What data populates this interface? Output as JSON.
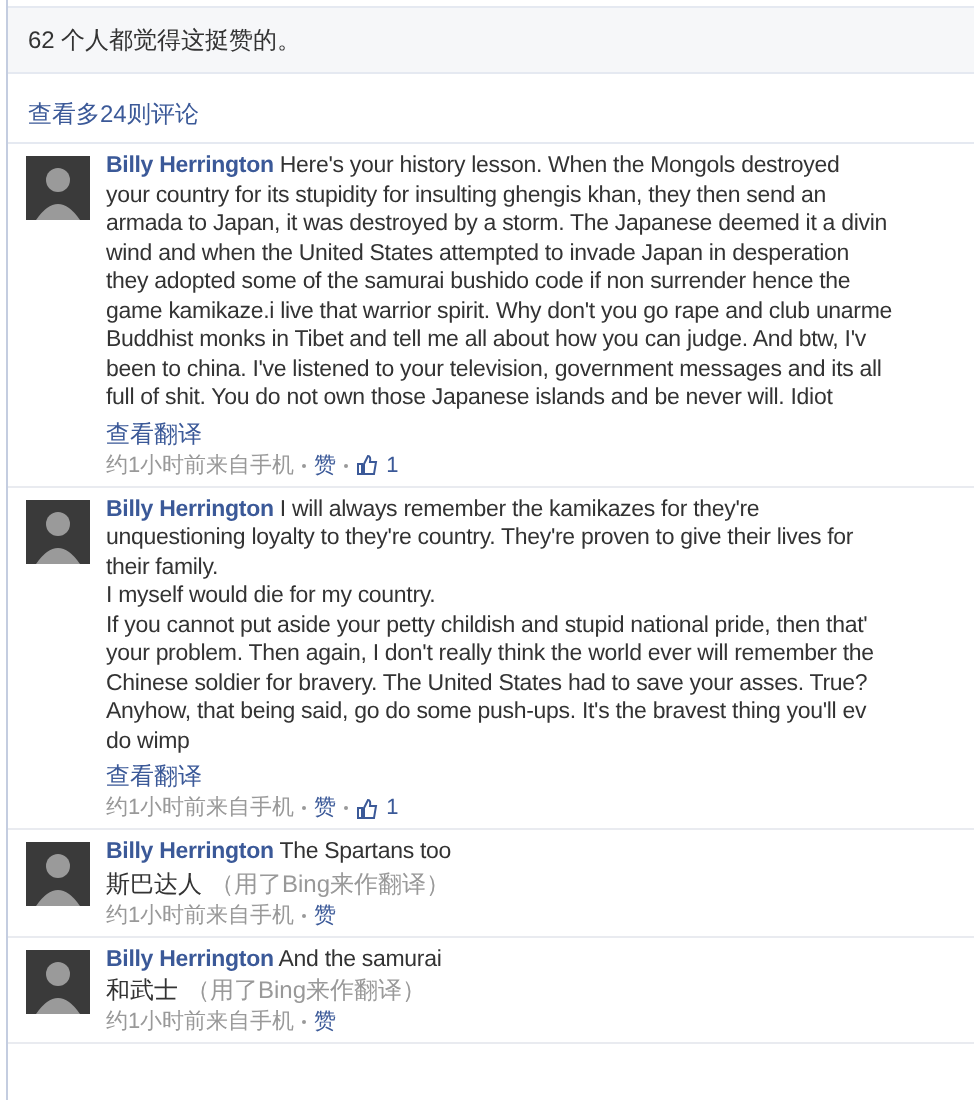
{
  "likes_summary": "62 个人都觉得这挺赞的。",
  "more_comments": "查看多24则评论",
  "comments": [
    {
      "author": "Billy Herrington",
      "lines": [
        "Here's your history lesson. When the Mongols destroyed",
        "your country for its stupidity for insulting ghengis khan, they then send an",
        "armada to Japan, it was destroyed by a storm. The Japanese deemed it a divin",
        "wind and when the United States attempted to invade Japan in desperation",
        "they adopted some of the samurai bushido code if non surrender hence the",
        "game kamikaze.i live that warrior spirit. Why don't you go rape and club unarme",
        "Buddhist monks in Tibet and tell me all about how you can judge. And btw, I'v",
        "been to china. I've listened to your television, government messages and its all",
        "full of shit. You do not own those Japanese islands and be never will. Idiot"
      ],
      "see_translation": "查看翻译",
      "time": "约1小时前来自手机",
      "like_label": "赞",
      "likes": "1"
    },
    {
      "author": "Billy Herrington",
      "lines": [
        "I will always remember the kamikazes for they're",
        "unquestioning loyalty to they're country. They're proven to give their lives for",
        "their family.",
        "I myself would die for my country.",
        "If you cannot put aside your petty childish and stupid national pride, then that'",
        "your problem. Then again, I don't really think the world ever will remember the",
        "Chinese soldier for bravery. The United States had to save your asses. True?",
        "Anyhow, that being said, go do some push-ups. It's the bravest thing you'll ev",
        "do wimp"
      ],
      "see_translation": "查看翻译",
      "time": "约1小时前来自手机",
      "like_label": "赞",
      "likes": "1"
    },
    {
      "author": "Billy Herrington",
      "lines": [
        "The Spartans too"
      ],
      "translation": "斯巴达人",
      "translation_note": "（用了Bing来作翻译）",
      "time": "约1小时前来自手机",
      "like_label": "赞"
    },
    {
      "author": "Billy Herrington",
      "lines": [
        "And the samurai"
      ],
      "translation": "和武士",
      "translation_note": "（用了Bing来作翻译）",
      "time": "约1小时前来自手机",
      "like_label": "赞"
    }
  ]
}
